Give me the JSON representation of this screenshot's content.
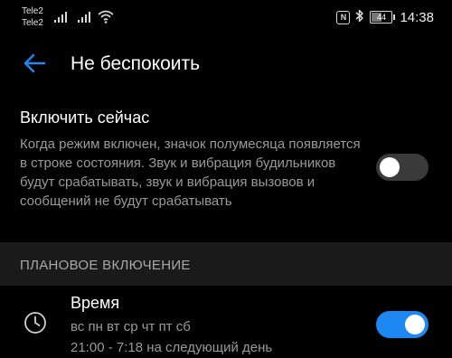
{
  "status_bar": {
    "carrier1": "Tele2",
    "carrier2": "Tele2",
    "nfc_icon": "nfc-icon",
    "bluetooth_icon": "bluetooth-icon",
    "battery_level": "44",
    "time": "14:38"
  },
  "app_bar": {
    "back_icon": "arrow-back-icon",
    "title": "Не беспокоить"
  },
  "now_setting": {
    "title": "Включить сейчас",
    "description": "Когда режим включен, значок полумесяца появляется в строке состояния. Звук и вибрация будильников будут срабатывать, звук и вибрация вызовов и сообщений не будут срабатывать",
    "enabled": false
  },
  "section": {
    "title": "ПЛАНОВОЕ ВКЛЮЧЕНИЕ"
  },
  "schedule": {
    "icon": "clock-icon",
    "title": "Время",
    "days": "вс пн вт ср чт пт сб",
    "time_range": "21:00 - 7:18 на следующий день",
    "enabled": true
  },
  "colors": {
    "accent": "#1e88f2",
    "background": "#000000",
    "section_bg": "#1a1a1a",
    "secondary_text": "#9a9a9a"
  }
}
